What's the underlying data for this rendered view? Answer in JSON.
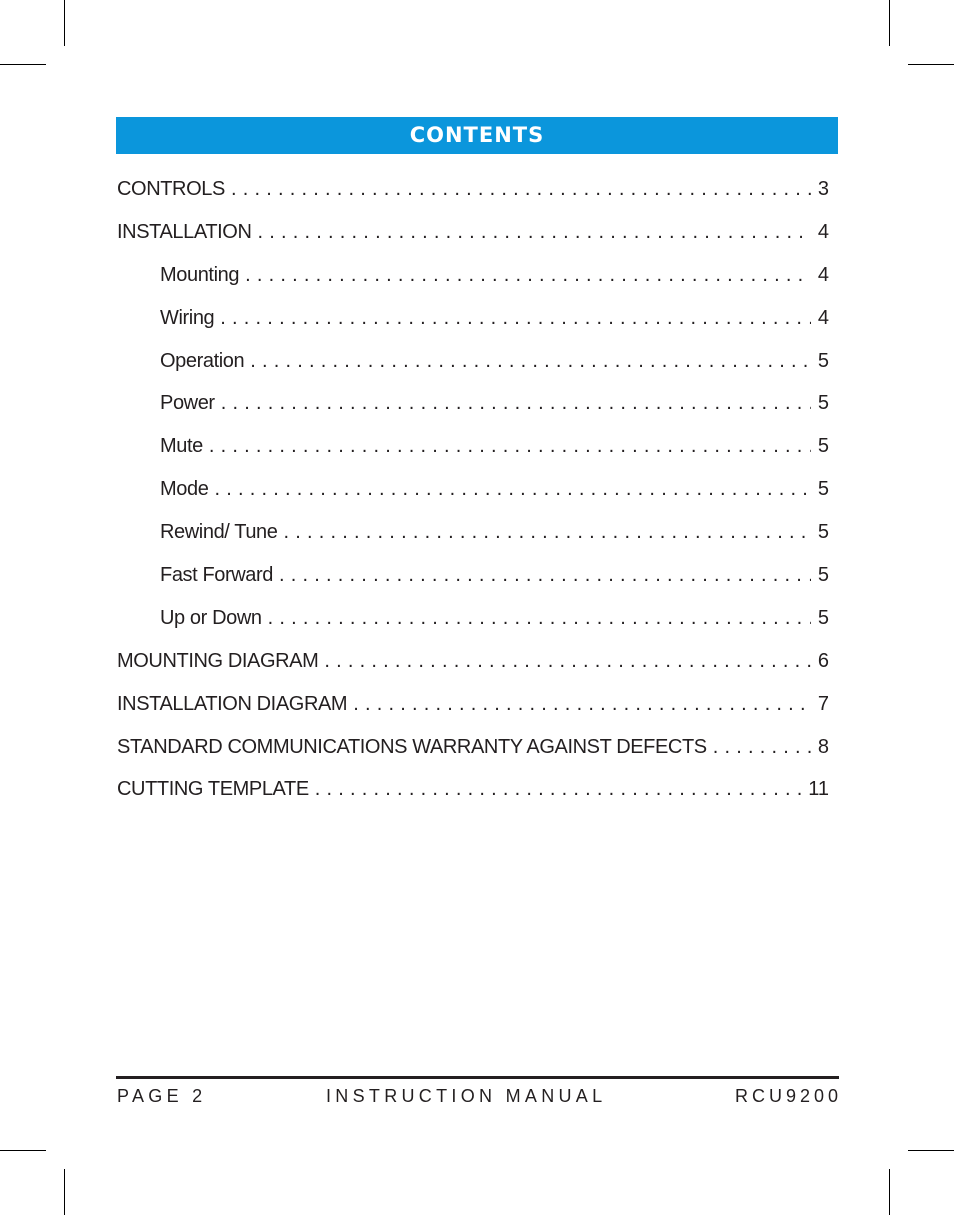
{
  "header": {
    "title": "CONTENTS"
  },
  "toc": [
    {
      "label": "CONTROLS",
      "page": "3",
      "level": 1
    },
    {
      "label": "INSTALLATION",
      "page": "4",
      "level": 1
    },
    {
      "label": "Mounting",
      "page": "4",
      "level": 2
    },
    {
      "label": "Wiring",
      "page": "4",
      "level": 2
    },
    {
      "label": "Operation",
      "page": "5",
      "level": 2
    },
    {
      "label": "Power",
      "page": "5",
      "level": 2
    },
    {
      "label": "Mute",
      "page": "5",
      "level": 2
    },
    {
      "label": "Mode",
      "page": "5",
      "level": 2
    },
    {
      "label": "Rewind/ Tune",
      "page": "5",
      "level": 2
    },
    {
      "label": "Fast Forward",
      "page": "5",
      "level": 2
    },
    {
      "label": "Up or Down",
      "page": "5",
      "level": 2
    },
    {
      "label": "MOUNTING DIAGRAM",
      "page": "6",
      "level": 1
    },
    {
      "label": "INSTALLATION DIAGRAM",
      "page": "7",
      "level": 1
    },
    {
      "label": "STANDARD COMMUNICATIONS WARRANTY AGAINST DEFECTS",
      "page": "8",
      "level": 1
    },
    {
      "label": "CUTTING TEMPLATE",
      "page": "11",
      "level": 1
    }
  ],
  "footer": {
    "page": "PAGE 2",
    "title": "INSTRUCTION MANUAL",
    "model": "RCU9200"
  },
  "colors": {
    "banner": "#0b96dc",
    "text": "#231f20"
  }
}
